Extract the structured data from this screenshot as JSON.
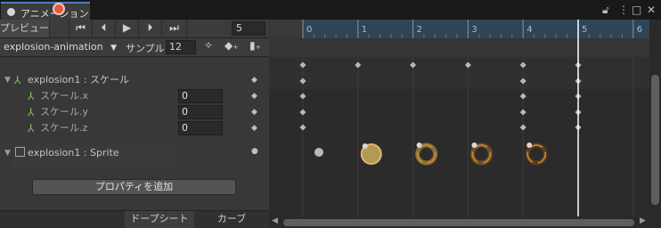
{
  "window": {
    "tab_title": "アニメーション",
    "lock_icon": "lock-icon",
    "menu_icon": "kebab-icon",
    "maximize_icon": "maximize-icon",
    "close_icon": "close-icon"
  },
  "toolbar": {
    "preview_label": "プレビュー",
    "current_frame": "5",
    "clip_name": "explosion-animation",
    "sample_label": "サンプル",
    "sample_rate": "12"
  },
  "timeline": {
    "ruler_labels": [
      "0",
      "1",
      "2",
      "3",
      "4",
      "5",
      "6"
    ],
    "playhead_time": 5
  },
  "properties": {
    "scale_group": "explosion1 : スケール",
    "scale_x_label": "スケール.x",
    "scale_y_label": "スケール.y",
    "scale_z_label": "スケール.z",
    "scale_x_value": "0",
    "scale_y_value": "0",
    "scale_z_value": "0",
    "sprite_label": "explosion1 : Sprite"
  },
  "keyframe_times": [
    0,
    1,
    2,
    3,
    4,
    5
  ],
  "add_property_label": "プロパティを追加",
  "bottom_tabs": {
    "dopesheet": "ドープシート",
    "curves": "カーブ"
  },
  "colors": {
    "record": "#e05a3a",
    "ruler_bg": "#2f4556",
    "playhead": "#ffffff"
  }
}
